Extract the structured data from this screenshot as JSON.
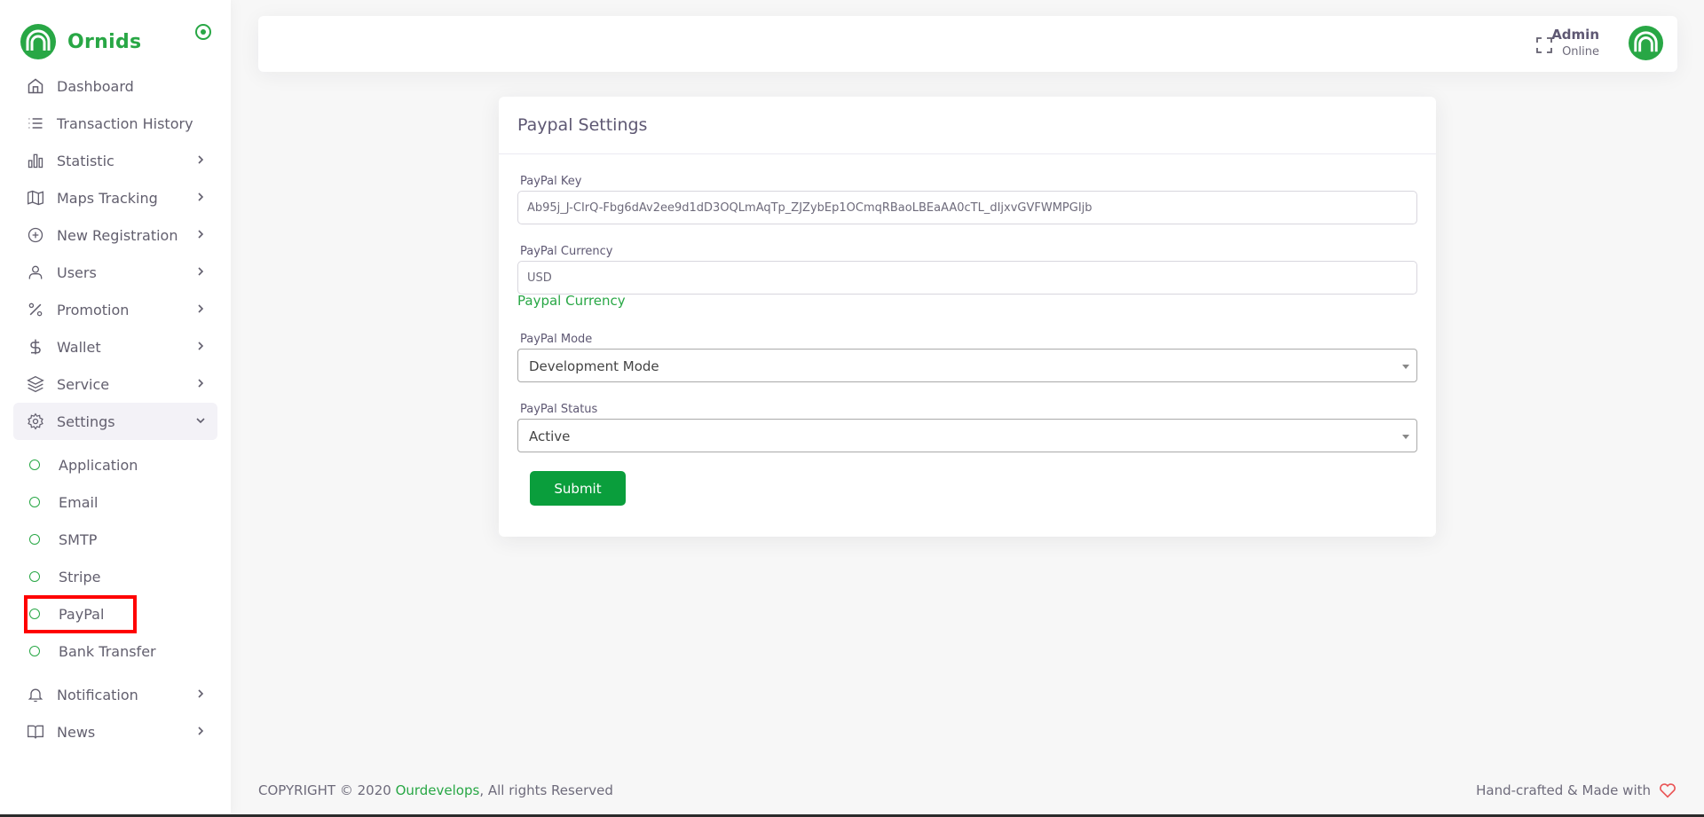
{
  "brand": {
    "name": "Ornids",
    "accent": "#28a745"
  },
  "sidebar": {
    "items": [
      {
        "label": "Dashboard",
        "icon": "home-icon",
        "has_chevron": false
      },
      {
        "label": "Transaction History",
        "icon": "list-icon",
        "has_chevron": false
      },
      {
        "label": "Statistic",
        "icon": "bar-chart-icon",
        "has_chevron": true
      },
      {
        "label": "Maps Tracking",
        "icon": "map-icon",
        "has_chevron": true
      },
      {
        "label": "New Registration",
        "icon": "plus-circle-icon",
        "has_chevron": true
      },
      {
        "label": "Users",
        "icon": "user-icon",
        "has_chevron": true
      },
      {
        "label": "Promotion",
        "icon": "percent-icon",
        "has_chevron": true
      },
      {
        "label": "Wallet",
        "icon": "dollar-icon",
        "has_chevron": true
      },
      {
        "label": "Service",
        "icon": "layers-icon",
        "has_chevron": true
      },
      {
        "label": "Settings",
        "icon": "gear-icon",
        "has_chevron": true,
        "expanded": true
      }
    ],
    "settings_submenu": [
      {
        "label": "Application"
      },
      {
        "label": "Email"
      },
      {
        "label": "SMTP"
      },
      {
        "label": "Stripe"
      },
      {
        "label": "PayPal",
        "active": true
      },
      {
        "label": "Bank Transfer"
      }
    ],
    "bottom_items": [
      {
        "label": "Notification",
        "icon": "bell-icon",
        "has_chevron": true
      },
      {
        "label": "News",
        "icon": "book-icon",
        "has_chevron": true
      }
    ]
  },
  "header": {
    "user_name": "Admin",
    "user_status": "Online"
  },
  "card": {
    "title": "Paypal Settings",
    "fields": {
      "key": {
        "label": "PayPal Key",
        "value": "Ab95j_J-CIrQ-Fbg6dAv2ee9d1dD3OQLmAqTp_ZJZybEp1OCmqRBaoLBEaAA0cTL_dIjxvGVFWMPGIjb"
      },
      "currency": {
        "label": "PayPal Currency",
        "value": "USD",
        "hint": "Paypal Currency"
      },
      "mode": {
        "label": "PayPal Mode",
        "selected": "Development Mode"
      },
      "status": {
        "label": "PayPal Status",
        "selected": "Active"
      }
    },
    "submit_label": "Submit"
  },
  "footer": {
    "copyright_prefix": "COPYRIGHT © 2020 ",
    "company": "Ourdevelops",
    "copyright_suffix": ", All rights Reserved",
    "right_text": "Hand-crafted & Made with"
  },
  "colors": {
    "primary_button": "#0a9e3c",
    "highlight": "#ff0000",
    "background": "#f7f7f7"
  }
}
